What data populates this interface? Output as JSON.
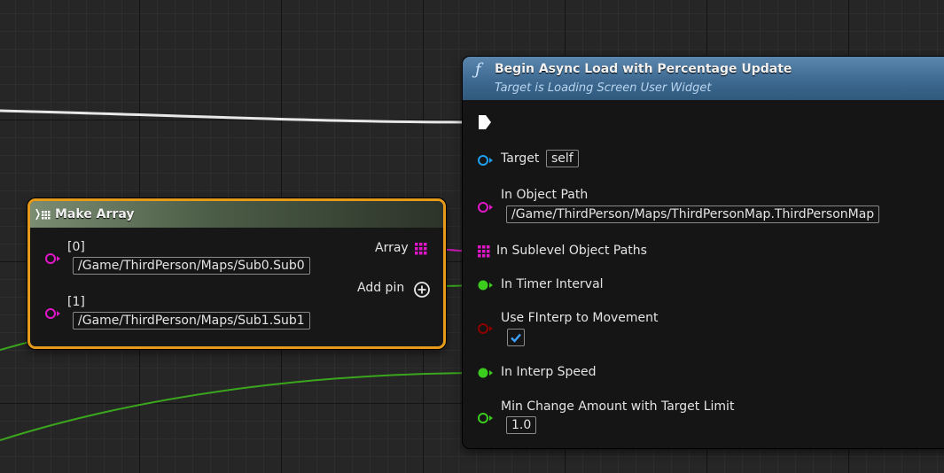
{
  "make_array": {
    "title": "Make Array",
    "pins": [
      {
        "label": "[0]",
        "value": "/Game/ThirdPerson/Maps/Sub0.Sub0"
      },
      {
        "label": "[1]",
        "value": "/Game/ThirdPerson/Maps/Sub1.Sub1"
      }
    ],
    "output_label": "Array",
    "add_pin_label": "Add pin"
  },
  "function_node": {
    "title": "Begin Async Load with Percentage Update",
    "subtitle": "Target is Loading Screen User Widget",
    "target": {
      "label": "Target",
      "value": "self"
    },
    "object_path": {
      "label": "In Object Path",
      "value": "/Game/ThirdPerson/Maps/ThirdPersonMap.ThirdPersonMap"
    },
    "sublevel_paths": {
      "label": "In Sublevel Object Paths"
    },
    "timer_interval": {
      "label": "In Timer Interval"
    },
    "use_finterp": {
      "label": "Use FInterp to Movement",
      "checked": true
    },
    "interp_speed": {
      "label": "In Interp Speed"
    },
    "min_change": {
      "label": "Min Change Amount with Target Limit",
      "value": "1.0"
    }
  },
  "colors": {
    "exec": "#ffffff",
    "object": "#1e9ff0",
    "string_pin": "#e016c8",
    "float_pin": "#3ccc1e",
    "bool_pin": "#8c0000",
    "selection_border": "#e69a1a"
  }
}
